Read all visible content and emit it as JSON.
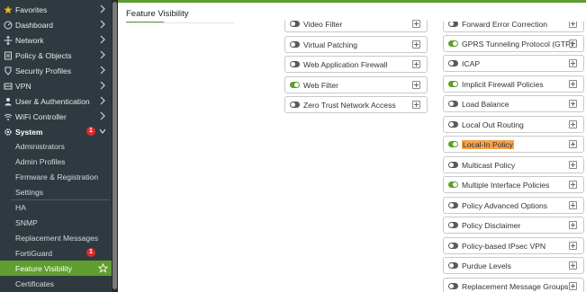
{
  "sidebar": {
    "items": [
      {
        "label": "Favorites",
        "icon": "star-icon"
      },
      {
        "label": "Dashboard",
        "icon": "dashboard-icon"
      },
      {
        "label": "Network",
        "icon": "network-icon"
      },
      {
        "label": "Policy & Objects",
        "icon": "policy-icon"
      },
      {
        "label": "Security Profiles",
        "icon": "security-profiles-icon"
      },
      {
        "label": "VPN",
        "icon": "vpn-icon"
      },
      {
        "label": "User & Authentication",
        "icon": "user-icon"
      },
      {
        "label": "WiFi Controller",
        "icon": "wifi-icon"
      }
    ],
    "system": {
      "label": "System",
      "badge": "1"
    },
    "system_items": [
      {
        "label": "Administrators"
      },
      {
        "label": "Admin Profiles"
      },
      {
        "label": "Firmware & Registration"
      },
      {
        "label": "Settings"
      },
      {
        "label": "HA"
      },
      {
        "label": "SNMP"
      },
      {
        "label": "Replacement Messages"
      },
      {
        "label": "FortiGuard",
        "badge": "1"
      },
      {
        "label": "Feature Visibility",
        "active": true
      },
      {
        "label": "Certificates"
      }
    ]
  },
  "main": {
    "tab_title": "Feature Visibility",
    "left_column": [
      {
        "label": "Video Filter",
        "state": "off"
      },
      {
        "label": "Virtual Patching",
        "state": "off"
      },
      {
        "label": "Web Application Firewall",
        "state": "off"
      },
      {
        "label": "Web Filter",
        "state": "on"
      },
      {
        "label": "Zero Trust Network Access",
        "state": "off"
      }
    ],
    "right_column": [
      {
        "label": "Forward Error Correction",
        "state": "off"
      },
      {
        "label": "GPRS Tunneling Protocol (GTP)",
        "state": "on"
      },
      {
        "label": "ICAP",
        "state": "off"
      },
      {
        "label": "Implicit Firewall Policies",
        "state": "on"
      },
      {
        "label": "Load Balance",
        "state": "off"
      },
      {
        "label": "Local Out Routing",
        "state": "off"
      },
      {
        "label": "Local-In Policy",
        "state": "on",
        "highlight": true
      },
      {
        "label": "Multicast Policy",
        "state": "off"
      },
      {
        "label": "Multiple Interface Policies",
        "state": "on"
      },
      {
        "label": "Policy Advanced Options",
        "state": "off"
      },
      {
        "label": "Policy Disclaimer",
        "state": "off"
      },
      {
        "label": "Policy-based IPsec VPN",
        "state": "off"
      },
      {
        "label": "Purdue Levels",
        "state": "off"
      },
      {
        "label": "Replacement Message Groups",
        "state": "off"
      }
    ]
  },
  "colors": {
    "accent": "#5f9e2f",
    "sidebar_bg": "#2e3a3f",
    "badge": "#e0292b",
    "search_highlight": "#f6a34a"
  }
}
